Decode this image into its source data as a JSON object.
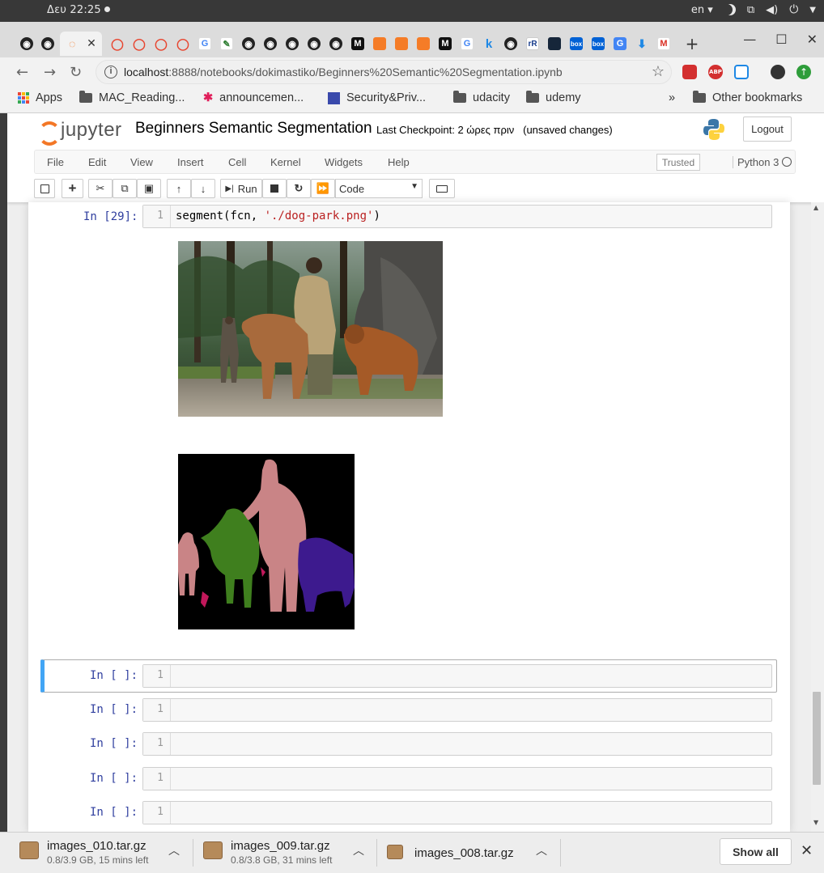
{
  "system_bar": {
    "clock": "Δευ 22:25",
    "language": "en"
  },
  "browser": {
    "address": {
      "host": "localhost",
      "rest": ":8888/notebooks/dokimastiko/Beginners%20Semantic%20Segmentation.ipynb"
    },
    "bookmarks": [
      {
        "label": "Apps"
      },
      {
        "label": "MAC_Reading..."
      },
      {
        "label": "announcemen..."
      },
      {
        "label": "Security&Priv..."
      },
      {
        "label": "udacity"
      },
      {
        "label": "udemy"
      }
    ],
    "overflow": "»",
    "other_bookmarks": "Other bookmarks"
  },
  "jupyter": {
    "logo_text": "jupyter",
    "notebook_name": "Beginners Semantic Segmentation",
    "checkpoint": "Last Checkpoint: 2 ώρες πριν",
    "unsaved": "(unsaved changes)",
    "logout": "Logout",
    "menus": [
      "File",
      "Edit",
      "View",
      "Insert",
      "Cell",
      "Kernel",
      "Widgets",
      "Help"
    ],
    "trusted": "Trusted",
    "kernel": "Python 3",
    "run_label": "Run",
    "cell_type": "Code"
  },
  "cells": {
    "executed": {
      "prompt": "In [29]:",
      "line": "1",
      "code_prefix": "segment(fcn, ",
      "code_string": "'./dog-park.png'",
      "code_suffix": ")"
    },
    "empty": [
      {
        "prompt": "In [ ]:",
        "line": "1"
      },
      {
        "prompt": "In [ ]:",
        "line": "1"
      },
      {
        "prompt": "In [ ]:",
        "line": "1"
      },
      {
        "prompt": "In [ ]:",
        "line": "1"
      },
      {
        "prompt": "In [ ]:",
        "line": "1"
      }
    ]
  },
  "downloads": [
    {
      "name": "images_010.tar.gz",
      "meta": "0.8/3.9 GB, 15 mins left"
    },
    {
      "name": "images_009.tar.gz",
      "meta": "0.8/3.8 GB, 31 mins left"
    },
    {
      "name": "images_008.tar.gz",
      "meta": ""
    }
  ],
  "show_all": "Show all",
  "colors": {
    "jupyter_orange": "#f37726",
    "prompt_blue": "#303f9f",
    "selected_cell": "#42a5f5",
    "seg_person": "#c98486",
    "seg_cow": "#3f7f1e",
    "seg_dog": "#3d1a8e",
    "seg_background": "#000000"
  }
}
